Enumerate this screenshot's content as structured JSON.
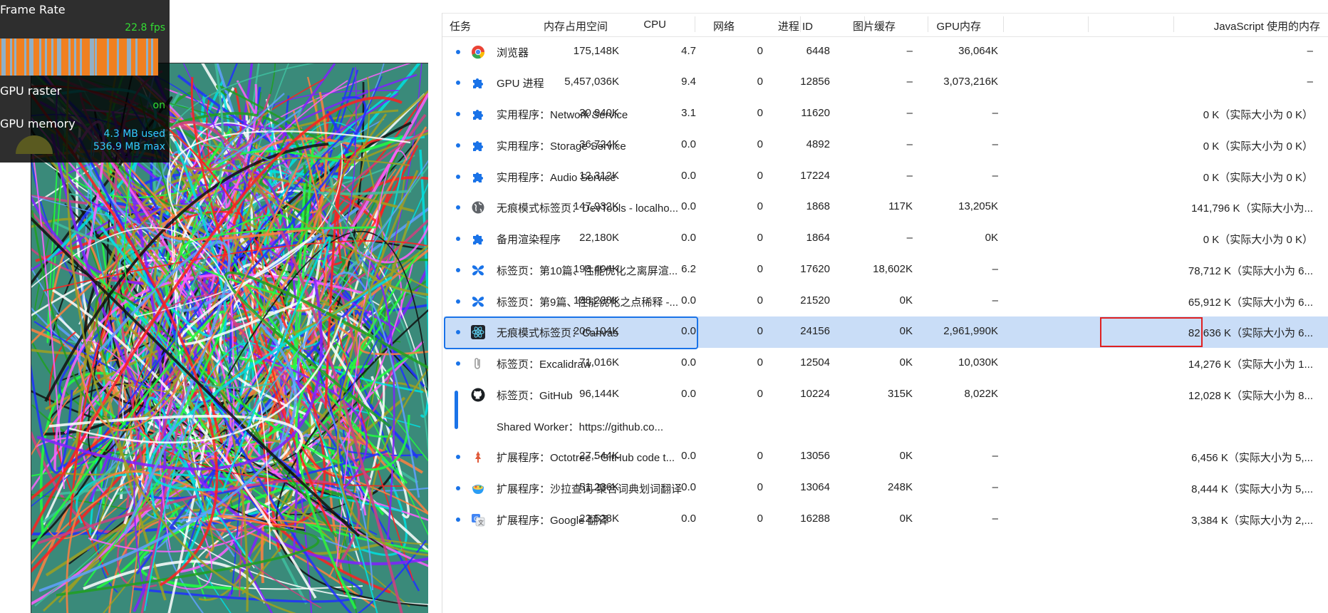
{
  "fps_meter": {
    "frame_rate_label": "Frame Rate",
    "frame_rate_value": "22.8 fps",
    "gpu_raster_label": "GPU raster",
    "gpu_raster_value": "on",
    "gpu_memory_label": "GPU memory",
    "gpu_memory_used": "4.3 MB used",
    "gpu_memory_max": "536.9 MB max",
    "colors": {
      "fps_value": "#33dd33",
      "raster_value": "#33dd33",
      "memory_value": "#33ccff",
      "bar_fill": "#f08020"
    }
  },
  "task_manager": {
    "columns": [
      "任务",
      "内存占用空间",
      "CPU",
      "网络",
      "进程 ID",
      "图片缓存",
      "GPU内存",
      "JavaScript 使用的内存"
    ],
    "rows": [
      {
        "icon": "chrome-icon",
        "name": "浏览器",
        "mem": "175,148K",
        "cpu": "4.7",
        "net": "0",
        "pid": "6448",
        "img": "–",
        "gpu": "36,064K",
        "js": "–"
      },
      {
        "icon": "puzzle-icon",
        "name": "GPU 进程",
        "mem": "5,457,036K",
        "cpu": "9.4",
        "net": "0",
        "pid": "12856",
        "img": "–",
        "gpu": "3,073,216K",
        "js": "–"
      },
      {
        "icon": "puzzle-icon",
        "name": "实用程序：Network Service",
        "mem": "30,940K",
        "cpu": "3.1",
        "net": "0",
        "pid": "11620",
        "img": "–",
        "gpu": "–",
        "js": "0 K（实际大小为 0 K）"
      },
      {
        "icon": "puzzle-icon",
        "name": "实用程序：Storage Service",
        "mem": "36,724K",
        "cpu": "0.0",
        "net": "0",
        "pid": "4892",
        "img": "–",
        "gpu": "–",
        "js": "0 K（实际大小为 0 K）"
      },
      {
        "icon": "puzzle-icon",
        "name": "实用程序：Audio Service",
        "mem": "12,312K",
        "cpu": "0.0",
        "net": "0",
        "pid": "17224",
        "img": "–",
        "gpu": "–",
        "js": "0 K（实际大小为 0 K）"
      },
      {
        "icon": "globe-icon",
        "name": "无痕模式标签页：DevTools - localho...",
        "mem": "147,932K",
        "cpu": "0.0",
        "net": "0",
        "pid": "1868",
        "img": "117K",
        "gpu": "13,205K",
        "js": "141,796 K（实际大小为..."
      },
      {
        "icon": "puzzle-icon",
        "name": "备用渲染程序",
        "mem": "22,180K",
        "cpu": "0.0",
        "net": "0",
        "pid": "1864",
        "img": "–",
        "gpu": "0K",
        "js": "0 K（实际大小为 0 K）"
      },
      {
        "icon": "butterfly-icon",
        "name": "标签页：第10篇、性能优化之离屏渲...",
        "mem": "193,404K",
        "cpu": "6.2",
        "net": "0",
        "pid": "17620",
        "img": "18,602K",
        "gpu": "–",
        "js": "78,712 K（实际大小为 6..."
      },
      {
        "icon": "butterfly-icon",
        "name": "标签页：第9篇、性能优化之点稀释 -...",
        "mem": "138,228K",
        "cpu": "0.0",
        "net": "0",
        "pid": "21520",
        "img": "0K",
        "gpu": "–",
        "js": "65,912 K（实际大小为 6..."
      },
      {
        "icon": "react-icon",
        "name": "无痕模式标签页：Canvas",
        "mem": "206,104K",
        "cpu": "0.0",
        "net": "0",
        "pid": "24156",
        "img": "0K",
        "gpu": "2,961,990K",
        "js": "82,636 K（实际大小为 6...",
        "selected": true,
        "highlight_gpu": true
      },
      {
        "icon": "paperclip-icon",
        "name": "标签页：Excalidraw",
        "mem": "71,016K",
        "cpu": "0.0",
        "net": "0",
        "pid": "12504",
        "img": "0K",
        "gpu": "10,030K",
        "js": "14,276 K（实际大小为 1..."
      },
      {
        "icon": "github-icon",
        "name": "标签页：GitHub",
        "mem": "96,144K",
        "cpu": "0.0",
        "net": "0",
        "pid": "10224",
        "img": "315K",
        "gpu": "8,022K",
        "js": "12,028 K（实际大小为 8...",
        "no_dot": true
      },
      {
        "icon": "",
        "name": "Shared Worker：https://github.co...",
        "mem": "",
        "cpu": "",
        "net": "",
        "pid": "",
        "img": "",
        "gpu": "",
        "js": "",
        "no_dot": true
      },
      {
        "icon": "octotree-icon",
        "name": "扩展程序：Octotree - GitHub code t...",
        "mem": "27,544K",
        "cpu": "0.0",
        "net": "0",
        "pid": "13056",
        "img": "0K",
        "gpu": "–",
        "js": "6,456 K（实际大小为 5,..."
      },
      {
        "icon": "bowl-icon",
        "name": "扩展程序：沙拉查词-聚合词典划词翻译",
        "mem": "51,236K",
        "cpu": "0.0",
        "net": "0",
        "pid": "13064",
        "img": "248K",
        "gpu": "–",
        "js": "8,444 K（实际大小为 5,..."
      },
      {
        "icon": "translate-icon",
        "name": "扩展程序：Google 翻译",
        "mem": "22,528K",
        "cpu": "0.0",
        "net": "0",
        "pid": "16288",
        "img": "0K",
        "gpu": "–",
        "js": "3,384 K（实际大小为 2,..."
      }
    ],
    "colors": {
      "selected_row": "#c9ddf7",
      "selected_border": "#1a73e8",
      "highlight_box": "#e02020",
      "status_dot": "#1a73e8"
    }
  }
}
